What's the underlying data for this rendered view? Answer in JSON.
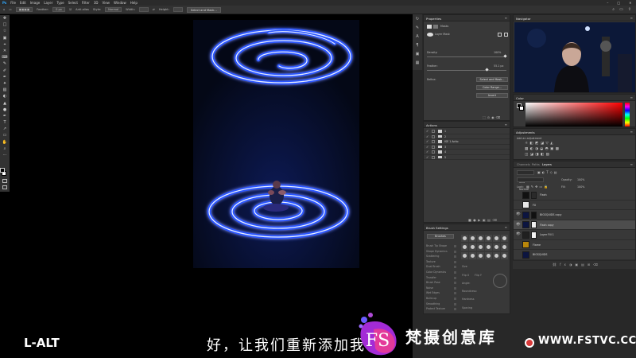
{
  "menubar": {
    "items": [
      "File",
      "Edit",
      "Image",
      "Layer",
      "Type",
      "Select",
      "Filter",
      "3D",
      "View",
      "Window",
      "Help"
    ],
    "win_controls": [
      "–",
      "□",
      "✕"
    ]
  },
  "options_bar": {
    "feather_label": "Feather:",
    "feather_value": "0 px",
    "antialias_label": "Anti-alias",
    "style_label": "Style:",
    "style_value": "Normal",
    "width_label": "Width:",
    "height_label": "Height:",
    "select_mask_button": "Select and Mask..."
  },
  "tools": [
    "✥",
    "□",
    "☆",
    "▣",
    "⌖",
    "✕",
    "⌨",
    "✎",
    "✐",
    "✒",
    "✦",
    "▧",
    "◐",
    "▲",
    "●",
    "✒",
    "T",
    "↗",
    "▭",
    "✋",
    "⌕",
    "⋯"
  ],
  "properties": {
    "title": "Properties",
    "mode_label": "Masks",
    "mask_label": "Layer Mask",
    "density_label": "Density:",
    "density_value": "100%",
    "feather_label": "Feather:",
    "feather_value": "55.1 px",
    "refine_label": "Refine:",
    "select_mask_button": "Select and Mask...",
    "color_range_button": "Color Range...",
    "invert_button": "Invert"
  },
  "navigator": {
    "title": "Navigator"
  },
  "color": {
    "title": "Color"
  },
  "adjustments": {
    "title": "Adjustments",
    "subtitle": "Add an adjustment"
  },
  "actions": {
    "title": "Actions",
    "rows": [
      {
        "label": "1",
        "checked": true
      },
      {
        "label": "2",
        "checked": true
      },
      {
        "label": "ISE 1 Actio",
        "checked": true
      },
      {
        "label": "3",
        "checked": true
      },
      {
        "label": "4",
        "checked": true
      },
      {
        "label": "5",
        "checked": true
      }
    ]
  },
  "brush_settings": {
    "title": "Brush Settings",
    "brushes_button": "Brushes",
    "items": [
      "Brush Tip Shape",
      "Shape Dynamics",
      "Scattering",
      "Texture",
      "Dual Brush",
      "Color Dynamics",
      "Transfer",
      "Brush Pose",
      "Noise",
      "Wet Edges",
      "Build-up",
      "Smoothing",
      "Protect Texture"
    ],
    "size_label": "Size",
    "flip_x": "Flip X",
    "flip_y": "Flip Y",
    "angle_label": "Angle:",
    "roundness_label": "Roundness:",
    "hardness_label": "Hardness",
    "spacing_label": "Spacing"
  },
  "layers": {
    "tabs": [
      "Channels",
      "Paths",
      "Layers"
    ],
    "kind_label": "Kind",
    "blend_mode": "Normal",
    "opacity_label": "Opacity:",
    "opacity_value": "100%",
    "lock_label": "Lock:",
    "fill_label": "Fill:",
    "fill_value": "100%",
    "rows": [
      {
        "name": "Flash",
        "selected": false,
        "visible": false,
        "thumb": "#111",
        "mask": "#2a2a2a"
      },
      {
        "name": "FX",
        "selected": false,
        "visible": false,
        "thumb": "#e8e8e8",
        "mask": ""
      },
      {
        "name": "BIGSQUIDS copy",
        "selected": false,
        "visible": true,
        "thumb": "#0c1540",
        "mask": "#111"
      },
      {
        "name": "Flash copy",
        "selected": true,
        "visible": true,
        "thumb": "#0c1540",
        "mask": "#f0f0f0"
      },
      {
        "name": "Layer Fill 1",
        "selected": false,
        "visible": true,
        "thumb": "#202020",
        "mask": "#f4f4f4"
      },
      {
        "name": "Flame",
        "selected": false,
        "visible": false,
        "thumb": "#b8860b",
        "mask": ""
      },
      {
        "name": "BIGSQUIDS",
        "selected": false,
        "visible": false,
        "thumb": "#0c1540",
        "mask": ""
      }
    ]
  },
  "overlay": {
    "shortcut": "L-ALT",
    "subtitle": "好，让我们重新添加我",
    "watermark_name": "梵摄创意库",
    "watermark_url": "WWW.FSTVC.CC",
    "watermark_logo": "FS"
  },
  "colors": {
    "neon": "#2b57ff",
    "neon_core": "#eef2ff",
    "accent_blue": "#31a8ff",
    "wm_purple": "#a32bd6",
    "wm_pink": "#ee3d8f"
  }
}
